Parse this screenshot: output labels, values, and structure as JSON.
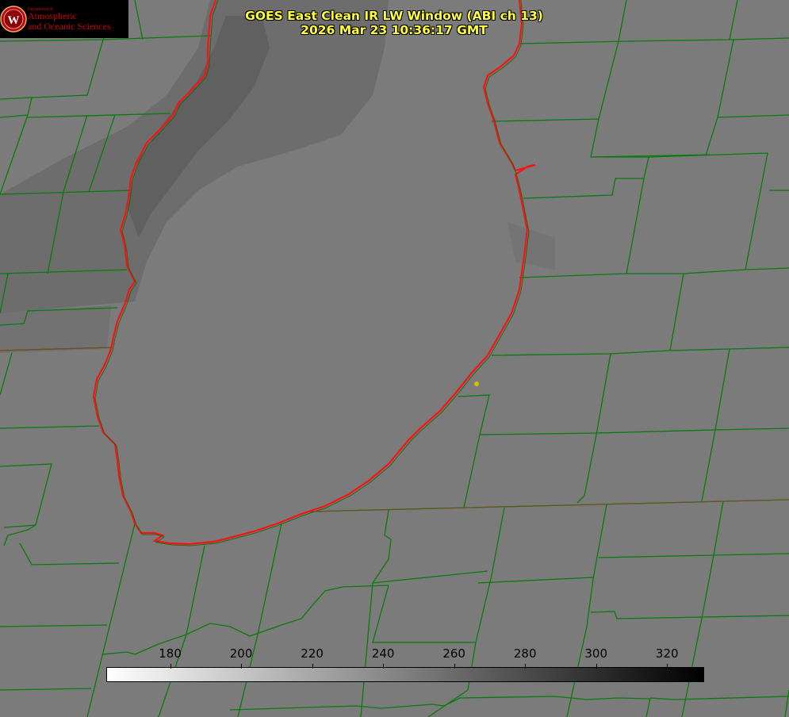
{
  "title": {
    "line1": "GOES East Clean IR LW Window (ABI ch 13)",
    "line2": "2026 Mar 23 10:36:17 GMT"
  },
  "logo": {
    "dept": "Department of",
    "line1": "Atmospheric",
    "line2": "and Oceanic Sciences",
    "shield_letter": "W"
  },
  "colorbar": {
    "ticks": [
      "180",
      "200",
      "220",
      "240",
      "260",
      "280",
      "300",
      "320"
    ],
    "tick_values": [
      180,
      200,
      220,
      240,
      260,
      280,
      300,
      320
    ],
    "min": 162,
    "max": 330,
    "color_low": "#ffffff",
    "color_high": "#000000"
  },
  "colors": {
    "background": "#7b7b7b",
    "cloud": "#666666",
    "county_lines": "#0a7a0a",
    "lake_outline": "#ff1010",
    "title_text": "#ffff3a",
    "marker": "#d4c400"
  }
}
